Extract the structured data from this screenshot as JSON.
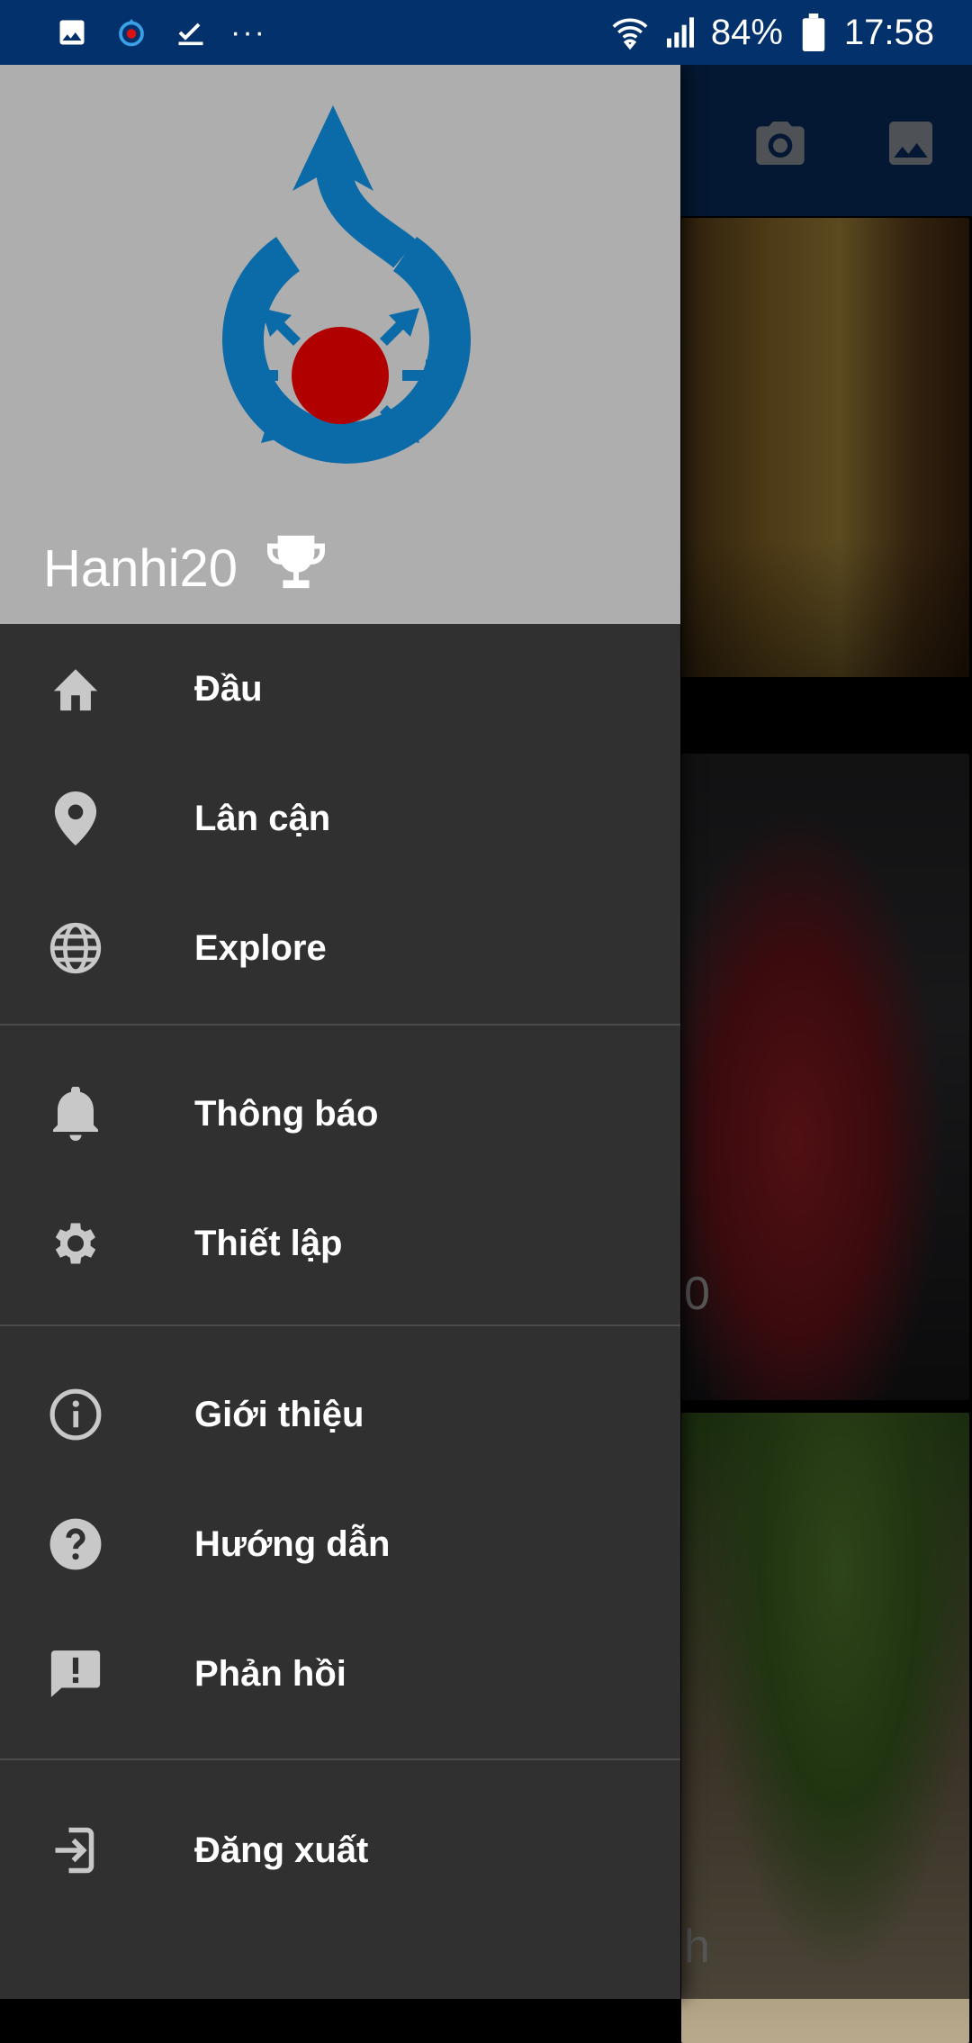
{
  "status_bar": {
    "battery": "84%",
    "time": "17:58",
    "dots": "···",
    "icons": [
      "gallery-icon",
      "location-icon",
      "check-icon",
      "wifi-icon",
      "signal-icon",
      "battery-icon"
    ]
  },
  "background": {
    "toolbar_icons": [
      "camera-icon",
      "gallery-icon"
    ],
    "caption_partial_1": "0",
    "caption_partial_2": "h"
  },
  "drawer": {
    "username": "Hanhi20",
    "sections": [
      [
        {
          "label": "Đầu",
          "icon": "home-icon"
        },
        {
          "label": "Lân cận",
          "icon": "location-pin-icon"
        },
        {
          "label": "Explore",
          "icon": "globe-icon"
        }
      ],
      [
        {
          "label": "Thông báo",
          "icon": "bell-icon"
        },
        {
          "label": "Thiết lập",
          "icon": "gear-icon"
        }
      ],
      [
        {
          "label": "Giới thiệu",
          "icon": "info-icon"
        },
        {
          "label": "Hướng dẫn",
          "icon": "help-icon"
        },
        {
          "label": "Phản hồi",
          "icon": "feedback-icon"
        }
      ],
      [
        {
          "label": "Đăng xuất",
          "icon": "logout-icon"
        }
      ]
    ]
  },
  "colors": {
    "status_bar": "#03316b",
    "drawer_bg": "#303030",
    "header_bg": "#aeaeae",
    "logo_blue": "#0b6aa8",
    "logo_red": "#b00000"
  }
}
